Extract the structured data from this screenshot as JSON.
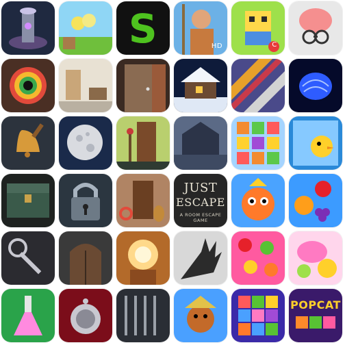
{
  "tiles": [
    {
      "name": "mystic-pillar-icon"
    },
    {
      "name": "green-dots-icon"
    },
    {
      "name": "letter-s-icon",
      "glyph": "S"
    },
    {
      "name": "spartan-warrior-icon",
      "badge": "HD"
    },
    {
      "name": "pixel-hero-icon",
      "badge": "C"
    },
    {
      "name": "brain-glasses-icon"
    },
    {
      "name": "color-eye-icon"
    },
    {
      "name": "white-room-icon"
    },
    {
      "name": "wooden-door-icon"
    },
    {
      "name": "snow-cabin-icon"
    },
    {
      "name": "diagonal-stripes-icon"
    },
    {
      "name": "blue-brain-icon"
    },
    {
      "name": "golden-bell-icon"
    },
    {
      "name": "moon-icon"
    },
    {
      "name": "green-room-door-icon"
    },
    {
      "name": "haunted-house-icon"
    },
    {
      "name": "fruit-match-icon"
    },
    {
      "name": "chick-puzzle-icon"
    },
    {
      "name": "treasure-chest-icon"
    },
    {
      "name": "padlock-icon"
    },
    {
      "name": "brick-room-icon"
    },
    {
      "name": "just-escape-icon",
      "lines": [
        "JUST",
        "ESCAPE",
        "A ROOM ESCAPE GAME"
      ]
    },
    {
      "name": "orange-monster-icon"
    },
    {
      "name": "fruit-splash-icon"
    },
    {
      "name": "ornate-key-icon"
    },
    {
      "name": "castle-gate-icon"
    },
    {
      "name": "bright-doorway-icon"
    },
    {
      "name": "shadow-hand-icon"
    },
    {
      "name": "fruit-crush-icon"
    },
    {
      "name": "candy-sweets-icon"
    },
    {
      "name": "pink-flask-icon"
    },
    {
      "name": "silver-locket-icon"
    },
    {
      "name": "prison-cell-icon"
    },
    {
      "name": "scarecrow-icon"
    },
    {
      "name": "block-puzzle-icon"
    },
    {
      "name": "popcat-icon",
      "title": "POPCAT"
    }
  ]
}
